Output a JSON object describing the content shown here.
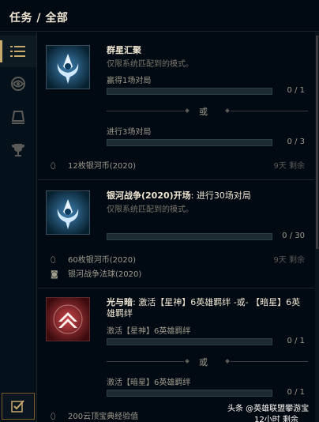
{
  "header": {
    "title": "任务 / 全部"
  },
  "sidebar": {
    "items": [
      {
        "name": "list-icon",
        "active": true
      },
      {
        "name": "swirl-icon",
        "active": false
      },
      {
        "name": "bell-icon",
        "active": false
      },
      {
        "name": "trophy-icon",
        "active": false
      }
    ],
    "bottom": {
      "name": "checkbox-icon"
    }
  },
  "quests": [
    {
      "icon": "galaxy-emblem-icon",
      "title": "群星汇聚",
      "title_rest": "",
      "subtitle": "仅限系统匹配到的模式。",
      "objectives": [
        {
          "label": "赢得1场对局",
          "count": "0 / 1",
          "progress": 0
        },
        {
          "label": "进行3场对局",
          "count": "0 / 3",
          "progress": 0
        }
      ],
      "or_label": "或",
      "rewards": [
        {
          "icon": "coin-icon",
          "text": "12枚银河币(2020)"
        }
      ],
      "expire": "9天 剩余"
    },
    {
      "icon": "galaxy-emblem-icon",
      "title": "银河战争(2020)开场",
      "title_rest": ": 进行30场对局",
      "subtitle": "仅限系统匹配到的模式。",
      "objectives": [
        {
          "label": "",
          "count": "0 / 30",
          "progress": 0
        }
      ],
      "rewards": [
        {
          "icon": "coin-icon",
          "text": "60枚银河币(2020)"
        },
        {
          "icon": "orb-icon",
          "text": "银河战争法球(2020)"
        }
      ],
      "expire": "9天 剩余"
    },
    {
      "icon": "chevron-emblem-icon",
      "title": "光与暗",
      "title_rest": ": 激活【星神】6英雄羁绊 -或- 【暗星】6英雄羁绊",
      "subtitle": "",
      "objectives": [
        {
          "label": "激活【星神】6英雄羁绊",
          "count": "0 / 1",
          "progress": 0
        },
        {
          "label": "激活【暗星】6英雄羁绊",
          "count": "0 / 1",
          "progress": 0
        }
      ],
      "or_label": "或",
      "rewards": [
        {
          "icon": "coin-icon",
          "text": "200云顶宝典经验值"
        }
      ],
      "expire": ""
    }
  ],
  "watermark": {
    "line1": "头条 @英雄联盟攀游宝",
    "line2": "12小时 剩余"
  },
  "colors": {
    "accent_gold": "#c8aa6e",
    "progress_teal": "#0ac8b9",
    "bg": "#010a13"
  }
}
